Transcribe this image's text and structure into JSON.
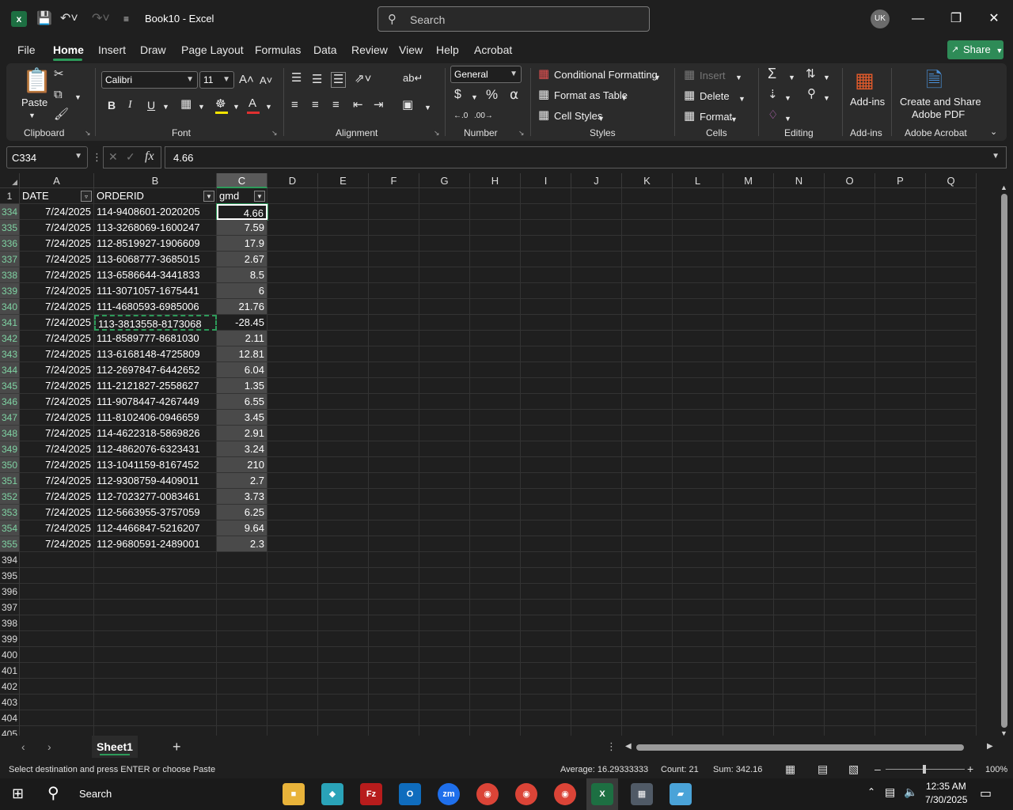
{
  "titlebar": {
    "app_icon": "excel-icon",
    "title": "Book10  -  Excel",
    "search_placeholder": "Search",
    "avatar": "UK"
  },
  "menu": {
    "tabs": [
      "File",
      "Home",
      "Insert",
      "Draw",
      "Page Layout",
      "Formulas",
      "Data",
      "Review",
      "View",
      "Help",
      "Acrobat"
    ],
    "active": "Home",
    "share_label": "Share"
  },
  "ribbon": {
    "clipboard": {
      "label": "Clipboard",
      "paste": "Paste"
    },
    "font": {
      "label": "Font",
      "name": "Calibri",
      "size": "11",
      "bold": "B",
      "italic": "I",
      "underline": "U"
    },
    "alignment": {
      "label": "Alignment"
    },
    "number": {
      "label": "Number",
      "format": "General"
    },
    "styles": {
      "label": "Styles",
      "conditional": "Conditional Formatting",
      "format_table": "Format as Table",
      "cell_styles": "Cell Styles"
    },
    "cells": {
      "label": "Cells",
      "insert": "Insert",
      "delete": "Delete",
      "format": "Format"
    },
    "editing": {
      "label": "Editing"
    },
    "addins": {
      "label": "Add-ins",
      "button": "Add-ins"
    },
    "acrobat": {
      "label": "Adobe Acrobat",
      "line1": "Create and Share",
      "line2": "Adobe PDF"
    }
  },
  "formula_bar": {
    "name_box": "C334",
    "value": "4.66"
  },
  "columns": [
    "A",
    "B",
    "C",
    "D",
    "E",
    "F",
    "G",
    "H",
    "I",
    "J",
    "K",
    "L",
    "M",
    "N",
    "O",
    "P",
    "Q"
  ],
  "header_row": {
    "row_num": "1",
    "date": "DATE",
    "orderid": "ORDERID",
    "gmd": "gmd"
  },
  "rows": [
    {
      "n": "334",
      "date": "7/24/2025",
      "id": "114-9408601-2020205",
      "gmd": "4.66"
    },
    {
      "n": "335",
      "date": "7/24/2025",
      "id": "113-3268069-1600247",
      "gmd": "7.59"
    },
    {
      "n": "336",
      "date": "7/24/2025",
      "id": "112-8519927-1906609",
      "gmd": "17.9"
    },
    {
      "n": "337",
      "date": "7/24/2025",
      "id": "113-6068777-3685015",
      "gmd": "2.67"
    },
    {
      "n": "338",
      "date": "7/24/2025",
      "id": "113-6586644-3441833",
      "gmd": "8.5"
    },
    {
      "n": "339",
      "date": "7/24/2025",
      "id": "111-3071057-1675441",
      "gmd": "6"
    },
    {
      "n": "340",
      "date": "7/24/2025",
      "id": "111-4680593-6985006",
      "gmd": "21.76"
    },
    {
      "n": "341",
      "date": "7/24/2025",
      "id": "113-3813558-8173068",
      "gmd": "-28.45"
    },
    {
      "n": "342",
      "date": "7/24/2025",
      "id": "111-8589777-8681030",
      "gmd": "2.11"
    },
    {
      "n": "343",
      "date": "7/24/2025",
      "id": "113-6168148-4725809",
      "gmd": "12.81"
    },
    {
      "n": "344",
      "date": "7/24/2025",
      "id": "112-2697847-6442652",
      "gmd": "6.04"
    },
    {
      "n": "345",
      "date": "7/24/2025",
      "id": "111-2121827-2558627",
      "gmd": "1.35"
    },
    {
      "n": "346",
      "date": "7/24/2025",
      "id": "111-9078447-4267449",
      "gmd": "6.55"
    },
    {
      "n": "347",
      "date": "7/24/2025",
      "id": "111-8102406-0946659",
      "gmd": "3.45"
    },
    {
      "n": "348",
      "date": "7/24/2025",
      "id": "114-4622318-5869826",
      "gmd": "2.91"
    },
    {
      "n": "349",
      "date": "7/24/2025",
      "id": "112-4862076-6323431",
      "gmd": "3.24"
    },
    {
      "n": "350",
      "date": "7/24/2025",
      "id": "113-1041159-8167452",
      "gmd": "210"
    },
    {
      "n": "351",
      "date": "7/24/2025",
      "id": "112-9308759-4409011",
      "gmd": "2.7"
    },
    {
      "n": "352",
      "date": "7/24/2025",
      "id": "112-7023277-0083461",
      "gmd": "3.73"
    },
    {
      "n": "353",
      "date": "7/24/2025",
      "id": "112-5663955-3757059",
      "gmd": "6.25"
    },
    {
      "n": "354",
      "date": "7/24/2025",
      "id": "112-4466847-5216207",
      "gmd": "9.64"
    },
    {
      "n": "355",
      "date": "7/24/2025",
      "id": "112-9680591-2489001",
      "gmd": "2.3"
    }
  ],
  "empty_rows": [
    "394",
    "395",
    "396",
    "397",
    "398",
    "399",
    "400",
    "401",
    "402",
    "403",
    "404",
    "405"
  ],
  "sheet_tab": "Sheet1",
  "status": {
    "message": "Select destination and press ENTER or choose Paste",
    "average": "Average: 16.29333333",
    "count": "Count: 21",
    "sum": "Sum: 342.16",
    "zoom": "100%"
  },
  "taskbar": {
    "search": "Search",
    "time": "12:35 AM",
    "date": "7/30/2025"
  },
  "colors": {
    "accent": "#2d9b5a",
    "share": "#2e8b57"
  }
}
